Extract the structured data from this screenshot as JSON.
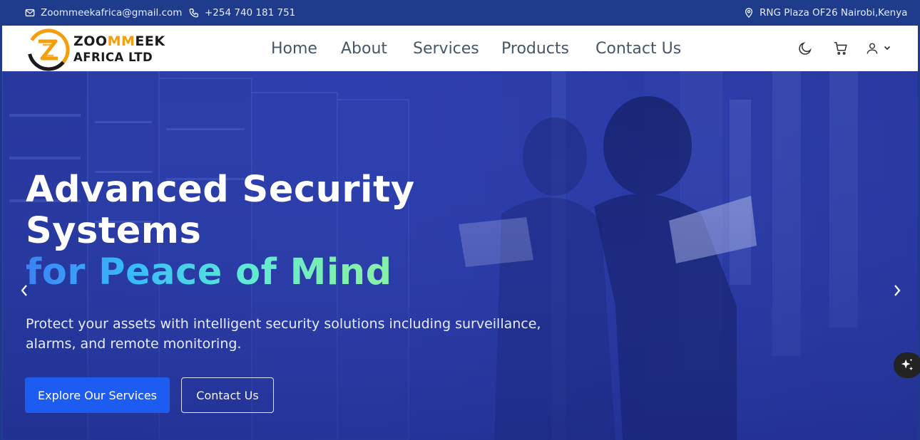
{
  "topbar": {
    "email": "Zoommeekafrica@gmail.com",
    "phone": "+254 740 181 751",
    "address": "RNG Plaza OF26 Nairobi,Kenya"
  },
  "logo": {
    "line1_a": "ZOO",
    "line1_b": "MM",
    "line1_c": "EEK",
    "line2": "AFRICA LTD"
  },
  "nav": {
    "items": [
      {
        "label": "Home"
      },
      {
        "label": "About"
      },
      {
        "label": "Services"
      },
      {
        "label": "Products"
      },
      {
        "label": "Contact Us"
      }
    ],
    "icons": [
      "moon-icon",
      "cart-icon",
      "user-icon",
      "chevron-down-icon"
    ]
  },
  "hero": {
    "title_line1": "Advanced Security",
    "title_line2": "Systems",
    "title_line3": "for Peace of Mind",
    "description": "Protect your assets with intelligent security solutions including surveillance, alarms, and remote monitoring.",
    "primary_button": "Explore Our Services",
    "secondary_button": "Contact Us"
  },
  "colors": {
    "topbar": "#1f3b8c",
    "hero_overlay": "#2d3fae",
    "primary_button": "#1d5cf0",
    "logo_accent": "#f59e0b"
  }
}
